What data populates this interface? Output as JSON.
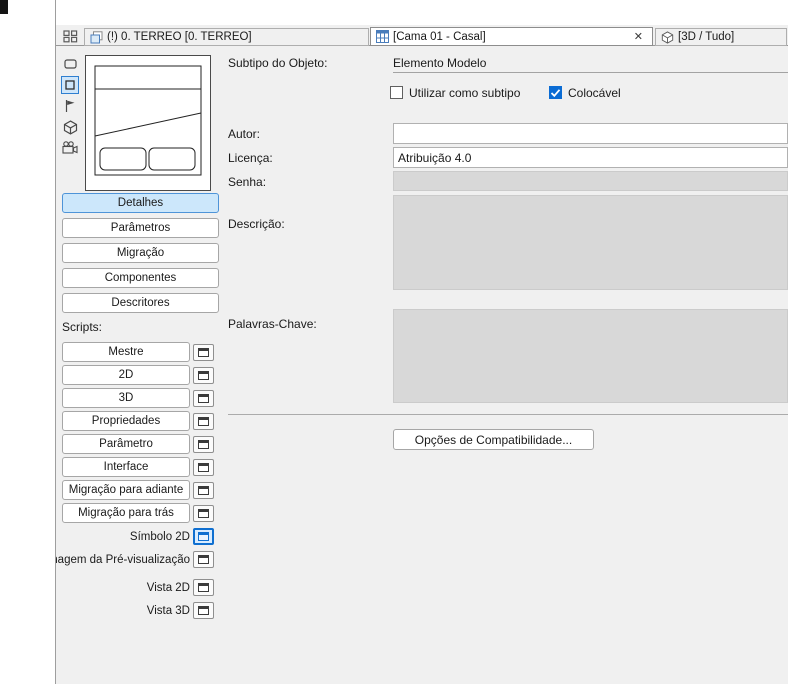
{
  "window": {
    "tabs": [
      {
        "label": "(!) 0. TÉRREO [0. TÉRREO]",
        "icon": "floor-plan-icon",
        "active": false
      },
      {
        "label": "[Cama 01 - Casal]",
        "icon": "gdl-object-icon",
        "active": true,
        "closable": true
      },
      {
        "label": "[3D / Tudo]",
        "icon": "cube-icon",
        "active": false
      }
    ],
    "close_icon": "✕"
  },
  "left_panel": {
    "section_buttons": [
      {
        "label": "Detalhes",
        "selected": true
      },
      {
        "label": "Parâmetros",
        "selected": false
      },
      {
        "label": "Migração",
        "selected": false
      },
      {
        "label": "Componentes",
        "selected": false
      },
      {
        "label": "Descritores",
        "selected": false
      }
    ],
    "scripts_heading": "Scripts:",
    "script_buttons": [
      {
        "label": "Mestre"
      },
      {
        "label": "2D"
      },
      {
        "label": "3D"
      },
      {
        "label": "Propriedades"
      },
      {
        "label": "Parâmetro"
      },
      {
        "label": "Interface"
      },
      {
        "label": "Migração para adiante"
      },
      {
        "label": "Migração para trás"
      }
    ],
    "view_rows": [
      {
        "label": "Símbolo 2D",
        "selected": true
      },
      {
        "label": "Imagem da Pré-visualização",
        "selected": false
      },
      {
        "label": "Vista 2D",
        "selected": false
      },
      {
        "label": "Vista 3D",
        "selected": false
      }
    ]
  },
  "form": {
    "subtype_label": "Subtipo do Objeto:",
    "subtype_value": "Elemento Modelo",
    "subtype_checkbox_label": "Utilizar como subtipo",
    "subtype_checkbox_checked": false,
    "placeable_checkbox_label": "Colocável",
    "placeable_checkbox_checked": true,
    "author_label": "Autor:",
    "author_value": "",
    "license_label": "Licença:",
    "license_value": "Atribuição 4.0",
    "password_label": "Senha:",
    "description_label": "Descrição:",
    "keywords_label": "Palavras-Chave:",
    "compatibility_button_label": "Opções de Compatibilidade..."
  },
  "colors": {
    "accent_blue": "#0b6cd4",
    "selected_button_bg": "#cce7fb",
    "panel_bg": "#f0f0f0",
    "disabled_field_bg": "#d8d8d8"
  }
}
